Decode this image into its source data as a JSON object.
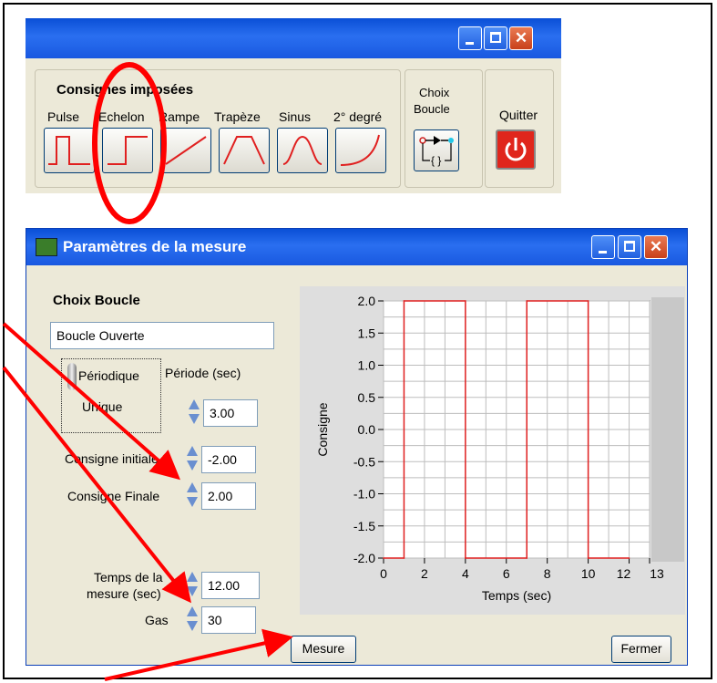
{
  "toolbar_window": {
    "group_label": "Consignes imposées",
    "signal_buttons": [
      {
        "label": "Pulse",
        "icon": "pulse-signal-icon"
      },
      {
        "label": "Echelon",
        "icon": "step-signal-icon"
      },
      {
        "label": "Rampe",
        "icon": "ramp-signal-icon"
      },
      {
        "label": "Trapèze",
        "icon": "trapezoid-signal-icon"
      },
      {
        "label": "Sinus",
        "icon": "sine-signal-icon"
      },
      {
        "label": "2° degré",
        "icon": "quadratic-signal-icon"
      }
    ],
    "choix_boucle_label_1": "Choix",
    "choix_boucle_label_2": "Boucle",
    "quit_label": "Quitter",
    "colors": {
      "titlebar": "#1958e0",
      "quit_button": "#e0261c",
      "signal_curve": "#e02020",
      "annotation": "#ff0000"
    }
  },
  "param_window": {
    "title": "Paramètres de la mesure",
    "choix_boucle_heading": "Choix Boucle",
    "boucle_value": "Boucle Ouverte",
    "toggle_top": "Périodique",
    "toggle_bottom": "Unique",
    "periode_label": "Période (sec)",
    "periode_value": "3.00",
    "consigne_initiale_label": "Consigne initiale",
    "consigne_initiale_value": "-2.00",
    "consigne_finale_label": "Consigne Finale",
    "consigne_finale_value": "2.00",
    "temps_mesure_label_1": "Temps de la",
    "temps_mesure_label_2": "mesure (sec)",
    "temps_mesure_value": "12.00",
    "gas_label": "Gas",
    "gas_value": "30",
    "mesure_button": "Mesure",
    "fermer_button": "Fermer"
  },
  "chart_data": {
    "type": "line",
    "title": "",
    "xlabel": "Temps (sec)",
    "ylabel": "Consigne",
    "xlim": [
      0,
      13
    ],
    "ylim": [
      -2.0,
      2.0
    ],
    "x_ticks": [
      "0",
      "2",
      "4",
      "6",
      "8",
      "10",
      "12",
      "13"
    ],
    "y_ticks": [
      "2.0",
      "1.5",
      "1.0",
      "0.5",
      "0.0",
      "-0.5",
      "-1.0",
      "-1.5",
      "-2.0"
    ],
    "grid": true,
    "series": [
      {
        "x": [
          0,
          1,
          1,
          4,
          4,
          7,
          7,
          10,
          10,
          12
        ],
        "y": [
          -2,
          -2,
          2,
          2,
          -2,
          -2,
          2,
          2,
          -2,
          -2
        ],
        "color": "#e02020"
      }
    ]
  }
}
